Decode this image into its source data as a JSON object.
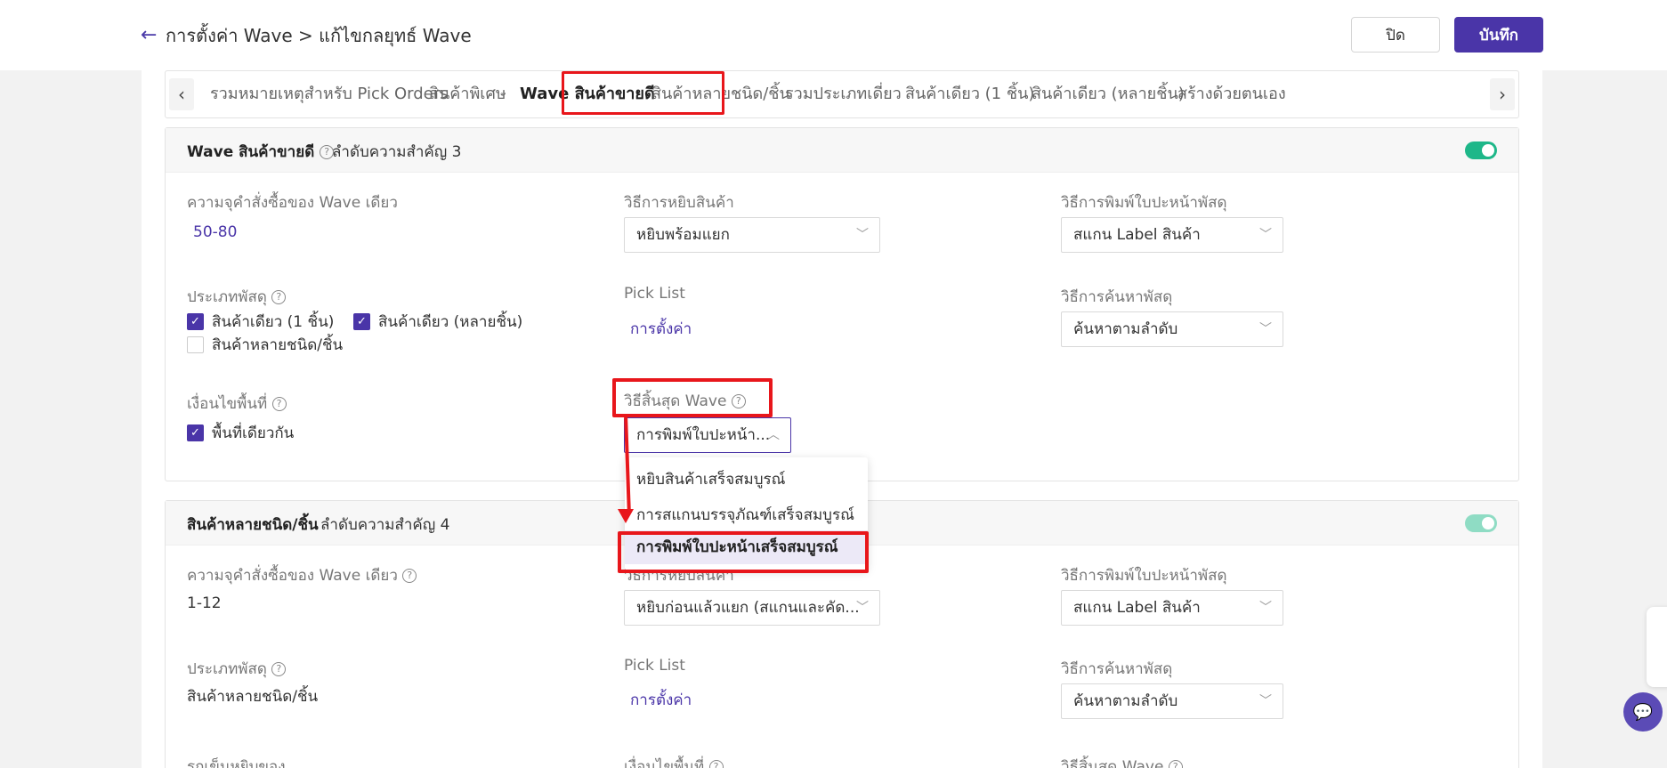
{
  "header": {
    "breadcrumb": "การตั้งค่า Wave > แก้ไขกลยุทธ์ Wave",
    "close_label": "ปิด",
    "save_label": "บันทึก"
  },
  "tabs": [
    {
      "label": "รวมหมายเหตุสำหรับ Pick Orders"
    },
    {
      "label": "สินค้าพิเศษ"
    },
    {
      "label": "Wave สินค้าขายดี",
      "active": true
    },
    {
      "label": "สินค้าหลายชนิด/ชิ้น"
    },
    {
      "label": "รวมประเภทเดี่ยว"
    },
    {
      "label": "สินค้าเดียว (1 ชิ้น)"
    },
    {
      "label": "สินค้าเดียว (หลายชิ้น)"
    },
    {
      "label": "สร้างด้วยตนเอง"
    }
  ],
  "card1": {
    "title": "Wave สินค้าขายดี",
    "priority": "ลำดับความสำคัญ 3",
    "enabled": true,
    "capacity_label": "ความจุคำสั่งซื้อของ Wave เดียว",
    "capacity_value": "50-80",
    "pick_method_label": "วิธีการหยิบสินค้า",
    "pick_method_value": "หยิบพร้อมแยก",
    "print_method_label": "วิธีการพิมพ์ใบปะหน้าพัสดุ",
    "print_method_value": "สแกน Label สินค้า",
    "parcel_type_label": "ประเภทพัสดุ",
    "parcel_types": [
      {
        "label": "สินค้าเดียว (1 ชิ้น)",
        "checked": true
      },
      {
        "label": "สินค้าเดียว (หลายชิ้น)",
        "checked": true
      },
      {
        "label": "สินค้าหลายชนิด/ชิ้น",
        "checked": false
      }
    ],
    "pick_list_label": "Pick List",
    "pick_list_link": "การตั้งค่า",
    "search_method_label": "วิธีการค้นหาพัสดุ",
    "search_method_value": "ค้นหาตามลำดับ",
    "area_label": "เงื่อนไขพื้นที่",
    "area_option": {
      "label": "พื้นที่เดียวกัน",
      "checked": true
    },
    "end_method_label": "วิธีสิ้นสุด Wave",
    "end_method_value": "การพิมพ์ใบปะหน้า..."
  },
  "dropdown": {
    "options": [
      "หยิบสินค้าเสร็จสมบูรณ์",
      "การสแกนบรรจุภัณฑ์เสร็จสมบูรณ์",
      "การพิมพ์ใบปะหน้าเสร็จสมบูรณ์"
    ],
    "selected_index": 2
  },
  "card2": {
    "title": "สินค้าหลายชนิด/ชิ้น",
    "priority": "ลำดับความสำคัญ 4",
    "enabled": true,
    "capacity_label": "ความจุคำสั่งซื้อของ Wave เดียว",
    "capacity_value": "1-12",
    "pick_method_label": "วิธีการหยิบสินค้า",
    "pick_method_value": "หยิบก่อนแล้วแยก (สแกนและคัด...",
    "print_method_label": "วิธีการพิมพ์ใบปะหน้าพัสดุ",
    "print_method_value": "สแกน Label สินค้า",
    "parcel_type_label": "ประเภทพัสดุ",
    "parcel_type_value": "สินค้าหลายชนิด/ชิ้น",
    "pick_list_label": "Pick List",
    "pick_list_link": "การตั้งค่า",
    "search_method_label": "วิธีการค้นหาพัสดุ",
    "search_method_value": "ค้นหาตามลำดับ",
    "cart_label": "รถเข็นหยิบของ",
    "area_label": "เงื่อนไขพื้นที่",
    "end_method_label": "วิธีสิ้นสุด Wave"
  },
  "colors": {
    "accent": "#4a35a8",
    "toggle_on": "#1eb789",
    "annotation": "#e8161b"
  }
}
